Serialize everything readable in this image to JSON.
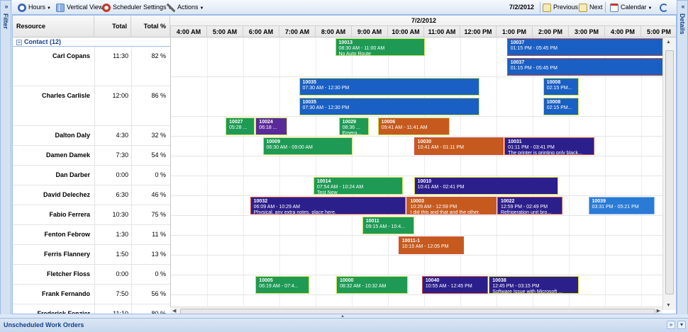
{
  "side_panels": {
    "left_label": "Filter",
    "right_label": "Details"
  },
  "toolbar": {
    "hours_label": "Hours",
    "vertical_view_label": "Vertical View",
    "scheduler_settings_label": "Scheduler Settings",
    "actions_label": "Actions",
    "date": "7/2/2012",
    "previous_label": "Previous",
    "next_label": "Next",
    "calendar_label": "Calendar"
  },
  "grid": {
    "columns": {
      "resource": "Resource",
      "total": "Total",
      "total_pct": "Total %"
    },
    "date_band": "7/2/2012",
    "hours": [
      "4:00 AM",
      "5:00 AM",
      "6:00 AM",
      "7:00 AM",
      "8:00 AM",
      "9:00 AM",
      "10:00 AM",
      "11:00 AM",
      "12:00 PM",
      "1:00 PM",
      "2:00 PM",
      "3:00 PM",
      "4:00 PM",
      "5:00 PM"
    ],
    "group_label": "Contact (12)",
    "resources": [
      {
        "name": "Carl Copans",
        "total": "11:30",
        "pct": "82 %"
      },
      {
        "name": "Charles Carlisle",
        "total": "12:00",
        "pct": "86 %"
      },
      {
        "name": "Dalton Daly",
        "total": "4:30",
        "pct": "32 %"
      },
      {
        "name": "Damen Damek",
        "total": "7:30",
        "pct": "54 %"
      },
      {
        "name": "Dan Darber",
        "total": "0:00",
        "pct": "0 %"
      },
      {
        "name": "David Delechez",
        "total": "6:30",
        "pct": "46 %"
      },
      {
        "name": "Fabio Ferrera",
        "total": "10:30",
        "pct": "75 %"
      },
      {
        "name": "Fenton Febrow",
        "total": "1:30",
        "pct": "11 %"
      },
      {
        "name": "Ferris Flannery",
        "total": "1:50",
        "pct": "13 %"
      },
      {
        "name": "Fletcher Floss",
        "total": "0:00",
        "pct": "0 %"
      },
      {
        "name": "Frank Fernando",
        "total": "7:50",
        "pct": "56 %"
      },
      {
        "name": "Frederick Fenzier",
        "total": "11:10",
        "pct": "80 %"
      }
    ]
  },
  "appointments": [
    {
      "id": "10013",
      "time": "08:30 AM - 11:00 AM",
      "note": "No Auto Route",
      "color": "green"
    },
    {
      "id": "10037",
      "time": "01:15 PM - 05:45 PM",
      "note": "",
      "color": "blue2"
    },
    {
      "id": "10037",
      "time": "01:15 PM - 05:45 PM",
      "note": "",
      "color": "blue2"
    },
    {
      "id": "10035",
      "time": "07:30 AM - 12:30 PM",
      "note": "",
      "color": "blue"
    },
    {
      "id": "10008",
      "time": "02:15 PM...",
      "note": "",
      "color": "blue"
    },
    {
      "id": "10035",
      "time": "07:30 AM - 12:30 PM",
      "note": "",
      "color": "blue"
    },
    {
      "id": "10008",
      "time": "02:15 PM...",
      "note": "",
      "color": "blue"
    },
    {
      "id": "10027",
      "time": "05:28 ...",
      "note": "",
      "color": "green"
    },
    {
      "id": "10024",
      "time": "06:18 ...",
      "note": "",
      "color": "purple"
    },
    {
      "id": "10029",
      "time": "08:36 ...",
      "note": "Emerg...",
      "color": "green"
    },
    {
      "id": "10006",
      "time": "09:41 AM - 11:41 AM",
      "note": "",
      "color": "orange"
    },
    {
      "id": "10009",
      "time": "06:30 AM - 09:00 AM",
      "note": "",
      "color": "green"
    },
    {
      "id": "10030",
      "time": "10:41 AM - 01:11 PM",
      "note": "",
      "color": "orange2"
    },
    {
      "id": "10031",
      "time": "01:11 PM - 03:41 PM",
      "note": "The printer is printing only black...",
      "color": "navy2"
    },
    {
      "id": "10014",
      "time": "07:54 AM - 10:24 AM",
      "note": "Test New",
      "color": "green"
    },
    {
      "id": "10010",
      "time": "10:41 AM - 02:41 PM",
      "note": "",
      "color": "navy"
    },
    {
      "id": "10032",
      "time": "06:09 AM - 10:29 AM",
      "note": "Physical, any extra notes, place here.",
      "color": "navy2"
    },
    {
      "id": "10003",
      "time": "10:29 AM - 12:59 PM",
      "note": "I did this and that and the other.",
      "color": "orange2"
    },
    {
      "id": "10022",
      "time": "12:59 PM - 02:49 PM",
      "note": "Refrigeration unit bro...",
      "color": "navy2"
    },
    {
      "id": "10039",
      "time": "03:31 PM - 05:21 PM",
      "note": "",
      "color": "lblue"
    },
    {
      "id": "10011",
      "time": "09:15 AM - 10:4...",
      "note": "",
      "color": "green"
    },
    {
      "id": "10011-1",
      "time": "10:15 AM - 12:05 PM",
      "note": "",
      "color": "orange2"
    },
    {
      "id": "10005",
      "time": "06:19 AM - 07:4...",
      "note": "",
      "color": "green"
    },
    {
      "id": "10000",
      "time": "08:32 AM - 10:32 AM",
      "note": "",
      "color": "green"
    },
    {
      "id": "10040",
      "time": "10:55 AM - 12:45 PM",
      "note": "",
      "color": "navy2"
    },
    {
      "id": "10038",
      "time": "12:45 PM - 03:15 PM",
      "note": "Software Issue with Microsoft ...",
      "color": "navy"
    }
  ],
  "bottom_panel": {
    "title": "Unscheduled Work Orders"
  },
  "colors": {
    "accent": "#15428b",
    "green": "#1e9a55",
    "blue": "#1a5fc4",
    "orange": "#c65a1e",
    "navy": "#2b1f8c"
  }
}
